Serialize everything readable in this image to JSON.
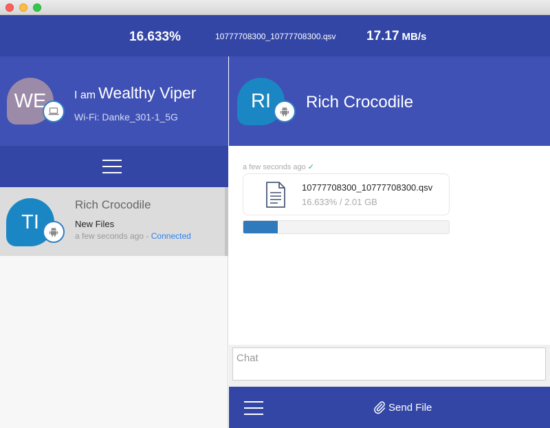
{
  "window": {
    "controls": [
      "close",
      "minimize",
      "zoom"
    ]
  },
  "transfer": {
    "percent": "16.633%",
    "file_name": "10777708300_10777708300.qsv",
    "speed_value": "17.17",
    "speed_unit": "MB/s"
  },
  "me": {
    "prefix": "I am",
    "name": "Wealthy Viper",
    "initials": "WE",
    "wifi": "Wi-Fi: Danke_301-1_5G",
    "device_icon": "laptop-icon",
    "avatar_color": "#9c8ba8"
  },
  "devices": [
    {
      "initials": "TI",
      "name": "Rich Crocodile",
      "status": "New Files",
      "time": "a few seconds ago",
      "separator": " - ",
      "connection": "Connected",
      "device_icon": "android-icon",
      "avatar_color": "#1a87c4"
    }
  ],
  "peer": {
    "initials": "RI",
    "name": "Rich Crocodile",
    "device_icon": "android-icon"
  },
  "messages": [
    {
      "time": "a few seconds ago",
      "status_icon": "checkmark-icon",
      "file_name": "10777708300_10777708300.qsv",
      "progress_text": "16.633% / 2.01 GB",
      "progress": 0.16633
    }
  ],
  "chat": {
    "placeholder": "Chat"
  },
  "actions": {
    "send_file_label": "Send File",
    "send_file_icon": "paperclip-icon"
  },
  "colors": {
    "primary": "#3f51b5",
    "primary_dark": "#3346a6",
    "accent_blue": "#2f80ed",
    "progress_fill": "#2f79bd"
  }
}
